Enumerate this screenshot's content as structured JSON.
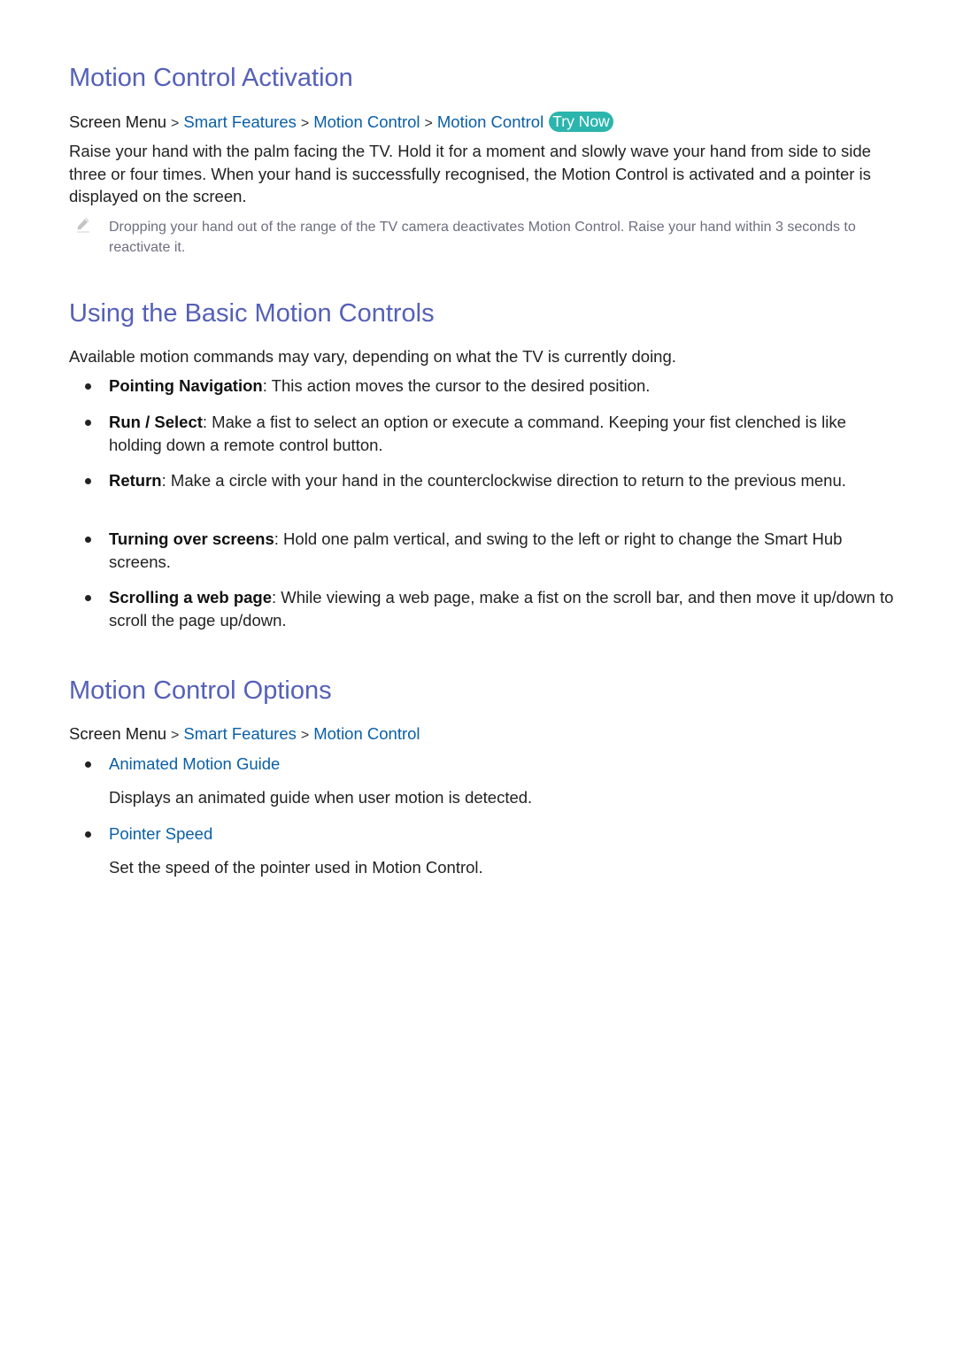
{
  "sections": {
    "activation": {
      "title": "Motion Control Activation",
      "path": {
        "root": "Screen Menu",
        "links": [
          "Smart Features",
          "Motion Control",
          "Motion Control"
        ],
        "separator": ">",
        "try_now": "Try Now"
      },
      "body": "Raise your hand with the palm facing the TV. Hold it for a moment and slowly wave your hand from side to side three or four times. When your hand is successfully recognised, the Motion Control is activated and a pointer is displayed on the screen.",
      "note": "Dropping your hand out of the range of the TV camera deactivates Motion Control. Raise your hand within 3 seconds to reactivate it.",
      "note_icon": "pencil-icon"
    },
    "basic": {
      "title": "Using the Basic Motion Controls",
      "intro": "Available motion commands may vary, depending on what the TV is currently doing.",
      "items": [
        {
          "term": "Pointing Navigation",
          "text": ": This action moves the cursor to the desired position."
        },
        {
          "term": "Run / Select",
          "text": ": Make a fist to select an option or execute a command. Keeping your fist clenched is like holding down a remote control button."
        },
        {
          "term": "Return",
          "text": ": Make a circle with your hand in the counterclockwise direction to return to the previous menu."
        },
        {
          "term": "Turning over screens",
          "text": ": Hold one palm vertical, and swing to the left or right to change the Smart Hub screens."
        },
        {
          "term": "Scrolling a web page",
          "text": ": While viewing a web page, make a fist on the scroll bar, and then move it up/down to scroll the page up/down."
        }
      ]
    },
    "options": {
      "title": "Motion Control Options",
      "path": {
        "root": "Screen Menu",
        "links": [
          "Smart Features",
          "Motion Control"
        ],
        "separator": ">"
      },
      "items": [
        {
          "title": "Animated Motion Guide",
          "desc": "Displays an animated guide when user motion is detected."
        },
        {
          "title": "Pointer Speed",
          "desc": "Set the speed of the pointer used in Motion Control."
        }
      ]
    }
  },
  "colors": {
    "heading": "#5560b8",
    "link": "#0a5fa8",
    "try_now_bg": "#2bb5ad",
    "note_text": "#6e6e80"
  }
}
